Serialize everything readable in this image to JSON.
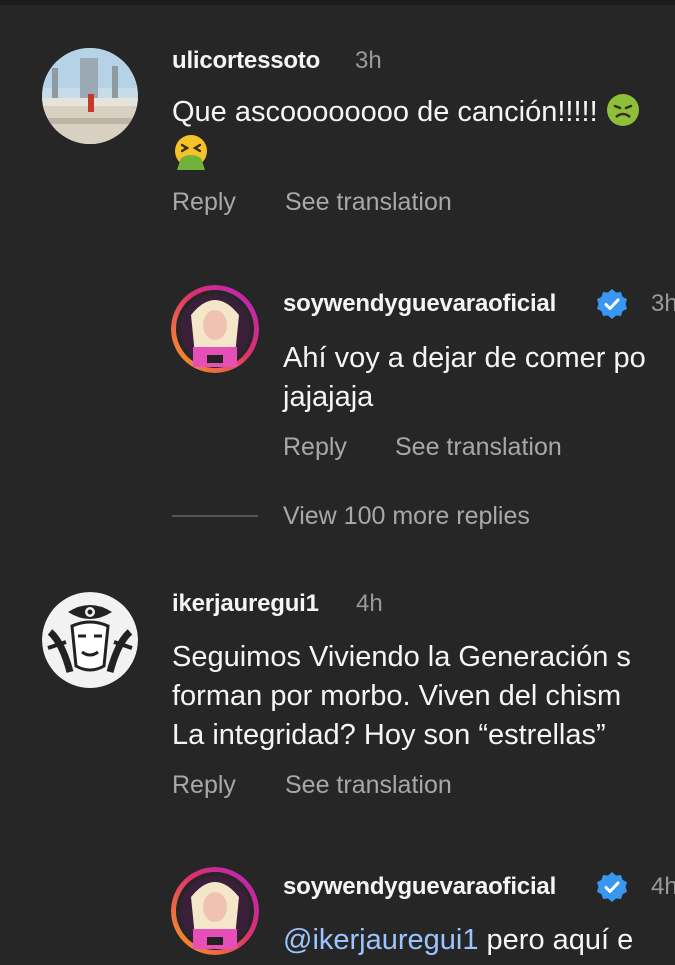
{
  "comments": [
    {
      "username": "ulicortessoto",
      "time": "3h",
      "line1": "Que ascoooooooo de canción!!!!!",
      "reply_label": "Reply",
      "translate_label": "See translation",
      "emoji_names": [
        "nauseated-face-emoji",
        "vomiting-face-emoji"
      ]
    },
    {
      "username": "soywendyguevaraoficial",
      "verified": true,
      "time": "3h",
      "line1": "Ahí voy a dejar de comer po",
      "line2": "jajajaja",
      "reply_label": "Reply",
      "translate_label": "See translation"
    },
    {
      "username": "ikerjauregui1",
      "time": "4h",
      "line1": "Seguimos Viviendo la Generación s",
      "line2": "forman por morbo. Viven del chism",
      "line3": "La integridad? Hoy son “estrellas”",
      "reply_label": "Reply",
      "translate_label": "See translation"
    },
    {
      "username": "soywendyguevaraoficial",
      "verified": true,
      "time": "4h",
      "mention": "@ikerjauregui1",
      "line1_rest": " pero aquí e"
    }
  ],
  "view_more": "View 100 more replies",
  "colors": {
    "background": "#262626",
    "secondary_text": "#a8a8a8",
    "verified_badge": "#3897f0",
    "story_ring": [
      "#f9a31b",
      "#e1306c",
      "#b023c8"
    ]
  }
}
